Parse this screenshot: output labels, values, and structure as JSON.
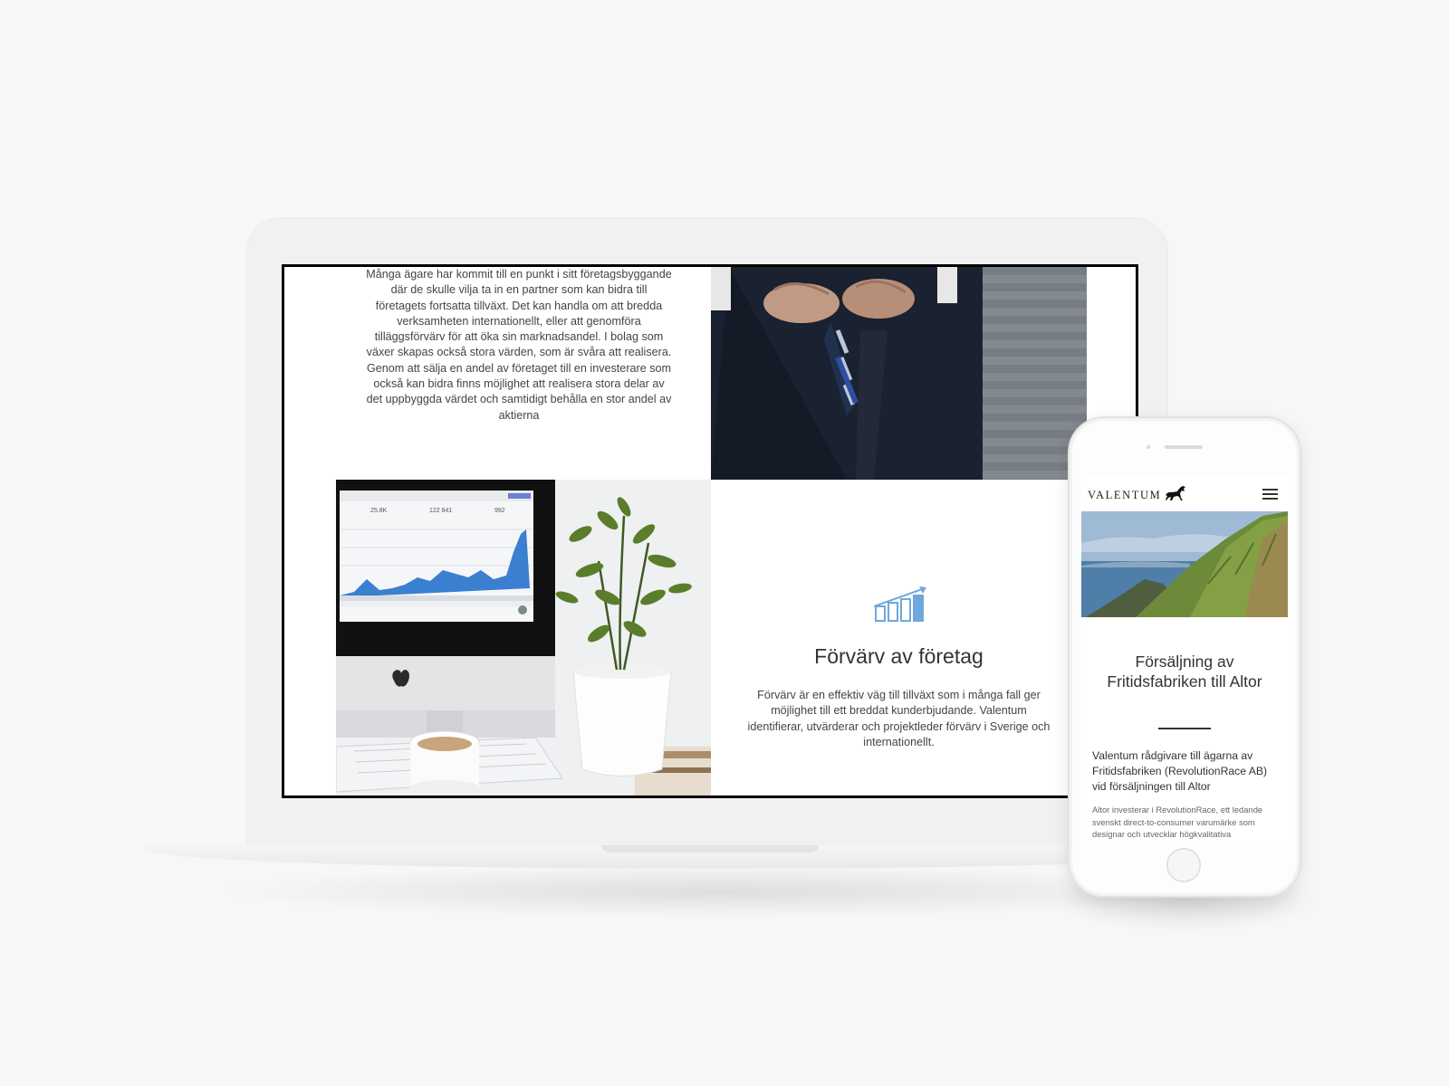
{
  "desktop": {
    "intro_paragraph": "Många ägare har kommit till en punkt i sitt företagsbyggande där de skulle vilja ta in en partner som kan bidra till företagets fortsatta tillväxt. Det kan handla om att bredda verksamheten internationellt, eller att genomföra tilläggsförvärv för att öka sin marknadsandel. I bolag som växer skapas också stora värden, som är svåra att realisera. Genom att sälja en andel av företaget till en investerare som också kan bidra finns möjlighet att realisera stora delar av det uppbyggda värdet och samtidigt behålla en stor andel av aktierna",
    "feature": {
      "icon": "growth-chart-icon",
      "title": "Förvärv av företag",
      "text": "Förvärv är en effektiv väg till tillväxt som i många fall ger möjlighet till ett breddat kunderbjudande. Valentum identifierar, utvärderar och projektleder förvärv i Sverige och internationellt."
    },
    "monitor_stats": [
      "25.8K",
      "122 841",
      "992"
    ],
    "accent_color": "#3b8fd6"
  },
  "mobile": {
    "logo": "VALENTUM",
    "logo_icon": "horse-icon",
    "menu_icon": "hamburger-menu-icon",
    "article_title": "Försäljning av Fritidsfabriken till Altor",
    "lead": "Valentum rådgivare till ägarna av Fritidsfabriken (RevolutionRace AB) vid försäljningen till Altor",
    "body": "Altor investerar i RevolutionRace, ett ledande svenskt direct-to-consumer varumärke som designar och utvecklar högkvalitativa"
  }
}
